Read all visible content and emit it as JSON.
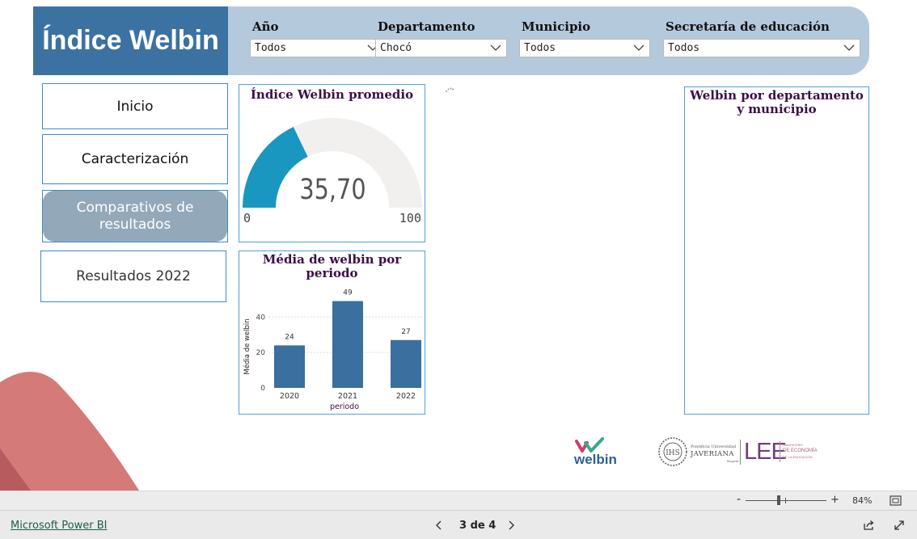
{
  "report": {
    "title": "Índice Welbin"
  },
  "filters": [
    {
      "label": "Año",
      "value": "Todos"
    },
    {
      "label": "Departamento",
      "value": "Chocó"
    },
    {
      "label": "Municipio",
      "value": "Todos"
    },
    {
      "label": "Secretaría de educación",
      "value": "Todos"
    }
  ],
  "nav": {
    "inicio": "Inicio",
    "caracterizacion": "Caracterización",
    "comparativos": "Comparativos de resultados",
    "resultados": "Resultados 2022"
  },
  "gauge": {
    "title": "Índice Welbin promedio",
    "value_label": "35,70",
    "value": 35.7,
    "min_label": "0",
    "max_label": "100",
    "min": 0,
    "max": 100,
    "fill_color": "#1a97c0",
    "track_color": "#f1f0ef"
  },
  "bar_card": {
    "title": "Média de welbin por periodo"
  },
  "chart_data": {
    "type": "bar",
    "title": "Média de welbin por periodo",
    "categories": [
      "2020",
      "2021",
      "2022"
    ],
    "values": [
      24,
      49,
      27
    ],
    "data_labels": [
      "24",
      "49",
      "27"
    ],
    "xlabel": "periodo",
    "ylabel": "Média de welbin",
    "yticks": [
      "0",
      "20",
      "40"
    ],
    "ylim": [
      0,
      52
    ],
    "bar_color": "#3a6f9f",
    "grid": true
  },
  "map_card": {
    "title": "Welbin por departamento y municipio"
  },
  "logos": {
    "welbin": "welbin",
    "javeriana_line1": "Pontificia Universidad",
    "javeriana_line2": "JAVERIANA",
    "javeriana_line3": "Bogotá",
    "lee": "LEE",
    "lee_sub1": "LABORATORIO",
    "lee_sub2": "DE ECONOMÍA",
    "lee_sub3": "DE LA EDUCACIÓN"
  },
  "zoom": {
    "minus": "-",
    "plus": "+",
    "level": "84%"
  },
  "bottom": {
    "brand": "Microsoft Power BI",
    "page": "3 de 4"
  },
  "colors": {
    "brand_blue": "#3c72a2",
    "filter_bar": "#b5c9dd",
    "nav_active": "#93a9ba",
    "card_border": "#4fa1d8",
    "title_purple": "#3a1048",
    "decor": "#d47a78"
  }
}
